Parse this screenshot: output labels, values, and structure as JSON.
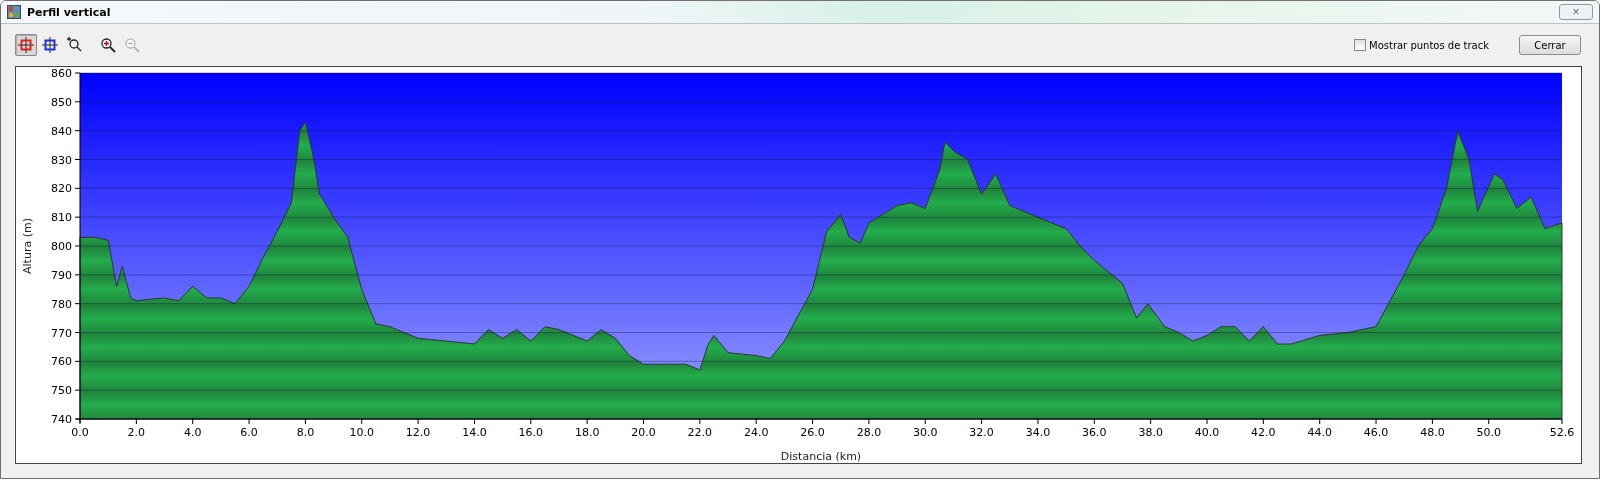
{
  "window": {
    "title": "Perfil vertical",
    "close": "×"
  },
  "toolbar": {
    "tools": [
      {
        "kind": "crosshair",
        "color": "#e02020",
        "selected": true,
        "disabled": false
      },
      {
        "kind": "crosshair",
        "color": "#2030e0",
        "selected": false,
        "disabled": false
      },
      {
        "kind": "zoom-box",
        "selected": false,
        "disabled": false
      },
      {
        "kind": "zoom-in",
        "selected": false,
        "disabled": false
      },
      {
        "kind": "zoom-out",
        "selected": false,
        "disabled": true
      }
    ],
    "checkbox": {
      "label": "Mostrar puntos de track",
      "checked": false
    },
    "button": "Cerrar"
  },
  "chart_data": {
    "type": "area",
    "xlabel": "Distancia (km)",
    "ylabel": "Altura (m)",
    "xlim": [
      0,
      52.6
    ],
    "ylim": [
      740,
      860
    ],
    "xticks": [
      {
        "value": 0,
        "label": "0.0"
      },
      {
        "value": 2,
        "label": "2.0"
      },
      {
        "value": 4,
        "label": "4.0"
      },
      {
        "value": 6,
        "label": "6.0"
      },
      {
        "value": 8,
        "label": "8.0"
      },
      {
        "value": 10,
        "label": "10.0"
      },
      {
        "value": 12,
        "label": "12.0"
      },
      {
        "value": 14,
        "label": "14.0"
      },
      {
        "value": 16,
        "label": "16.0"
      },
      {
        "value": 18,
        "label": "18.0"
      },
      {
        "value": 20,
        "label": "20.0"
      },
      {
        "value": 22,
        "label": "22.0"
      },
      {
        "value": 24,
        "label": "24.0"
      },
      {
        "value": 26,
        "label": "26.0"
      },
      {
        "value": 28,
        "label": "28.0"
      },
      {
        "value": 30,
        "label": "30.0"
      },
      {
        "value": 32,
        "label": "32.0"
      },
      {
        "value": 34,
        "label": "34.0"
      },
      {
        "value": 36,
        "label": "36.0"
      },
      {
        "value": 38,
        "label": "38.0"
      },
      {
        "value": 40,
        "label": "40.0"
      },
      {
        "value": 42,
        "label": "42.0"
      },
      {
        "value": 44,
        "label": "44.0"
      },
      {
        "value": 46,
        "label": "46.0"
      },
      {
        "value": 48,
        "label": "48.0"
      },
      {
        "value": 50,
        "label": "50.0"
      },
      {
        "value": 52.6,
        "label": "52.6"
      }
    ],
    "yticks": [
      740,
      750,
      760,
      770,
      780,
      790,
      800,
      810,
      820,
      830,
      840,
      850,
      860
    ],
    "x": [
      0,
      0.5,
      1.0,
      1.3,
      1.5,
      1.8,
      2,
      3,
      3.5,
      4,
      4.5,
      5,
      5.5,
      6,
      6.5,
      7,
      7.5,
      7.8,
      8,
      8.3,
      8.5,
      9,
      9.5,
      10,
      10.5,
      11,
      12,
      13,
      14,
      14.5,
      15,
      15.5,
      16,
      16.5,
      17,
      18,
      18.5,
      19,
      19.5,
      20,
      21,
      21.5,
      22,
      22.3,
      22.5,
      23,
      24,
      24.5,
      25,
      25.5,
      26,
      26.5,
      27,
      27.3,
      27.7,
      28,
      29,
      29.5,
      30,
      30.5,
      30.7,
      31,
      31.5,
      32,
      32.5,
      33,
      34,
      35,
      35.5,
      36,
      37,
      37.5,
      37.9,
      38.5,
      39,
      39.5,
      40,
      40.5,
      41,
      41.5,
      42,
      42.5,
      43,
      44,
      45,
      45.5,
      46,
      46.5,
      47,
      47.5,
      48,
      48.5,
      48.9,
      49.3,
      49.6,
      50.2,
      50.5,
      51,
      51.5,
      52,
      52.6
    ],
    "grid": true,
    "series": [
      {
        "values": [
          803,
          803,
          802,
          786,
          793,
          782,
          781,
          782,
          781,
          786,
          782,
          782,
          780,
          786,
          796,
          805,
          815,
          840,
          843,
          830,
          818,
          810,
          803,
          785,
          773,
          772,
          768,
          767,
          766,
          771,
          768,
          771,
          767,
          772,
          771,
          767,
          771,
          768,
          762,
          759,
          759,
          759,
          757,
          766,
          769,
          763,
          762,
          761,
          767,
          776,
          785,
          805,
          811,
          803,
          801,
          808,
          814,
          815,
          813,
          826,
          836,
          833,
          830,
          818,
          825,
          814,
          810,
          806,
          800,
          795,
          787,
          775,
          780,
          772,
          770,
          767,
          769,
          772,
          772,
          767,
          772,
          766,
          766,
          769,
          770,
          771,
          772,
          781,
          790,
          800,
          806,
          820,
          840,
          830,
          812,
          825,
          823,
          813,
          817,
          806,
          808
        ]
      }
    ]
  }
}
